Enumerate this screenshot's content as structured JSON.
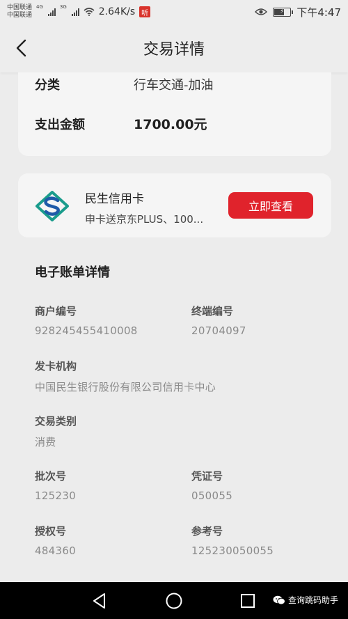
{
  "status_bar": {
    "carrier_1": "中国联通",
    "carrier_2": "中国联通",
    "network_1": "4G",
    "network_2": "3G",
    "speed": "2.64K/s",
    "app_badge": "听",
    "time": "下午4:47",
    "battery_level": 0.55,
    "icons": [
      "signal-icon",
      "wifi-icon",
      "eye-icon",
      "battery-icon"
    ]
  },
  "nav": {
    "title": "交易详情",
    "back_icon": "chevron-left-icon"
  },
  "summary": {
    "category_label": "分类",
    "category_value": "行车交通-加油",
    "amount_label": "支出金额",
    "amount_value": "1700.00元"
  },
  "promo": {
    "logo_icon": "cmbc-bank-logo",
    "title": "民生信用卡",
    "subtitle": "申卡送京东PLUS、100...",
    "button_label": "立即查看",
    "button_color": "#e0232c"
  },
  "bill": {
    "section_title": "电子账单详情",
    "merchant_no_label": "商户编号",
    "merchant_no_value": "928245455410008",
    "terminal_no_label": "终端编号",
    "terminal_no_value": "20704097",
    "issuer_label": "发卡机构",
    "issuer_value": "中国民生银行股份有限公司信用卡中心",
    "txn_type_label": "交易类别",
    "txn_type_value": "消费",
    "batch_no_label": "批次号",
    "batch_no_value": "125230",
    "voucher_no_label": "凭证号",
    "voucher_no_value": "050055",
    "auth_no_label": "授权号",
    "auth_no_value": "484360",
    "ref_no_label": "参考号",
    "ref_no_value": "125230050055"
  },
  "system_nav": {
    "back_icon": "triangle-back-icon",
    "home_icon": "circle-home-icon",
    "recents_icon": "square-recents-icon",
    "watermark": "查询跳码助手",
    "watermark_icon": "wechat-icon"
  }
}
